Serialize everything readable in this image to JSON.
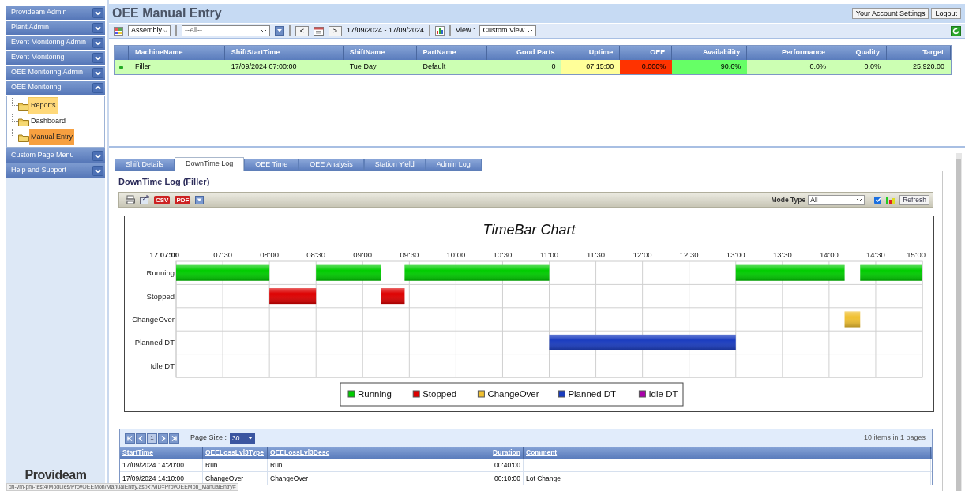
{
  "sidebar": {
    "menus": [
      {
        "label": "Provideam Admin",
        "expanded": false
      },
      {
        "label": "Plant Admin",
        "expanded": false
      },
      {
        "label": "Event Monitoring Admin",
        "expanded": false
      },
      {
        "label": "Event Monitoring",
        "expanded": false
      },
      {
        "label": "OEE Monitoring Admin",
        "expanded": false
      },
      {
        "label": "OEE Monitoring",
        "expanded": true,
        "children": [
          {
            "label": "Reports",
            "selected": false,
            "hovered": true
          },
          {
            "label": "Dashboard",
            "selected": false,
            "hovered": false
          },
          {
            "label": "Manual Entry",
            "selected": true,
            "hovered": false
          }
        ]
      },
      {
        "label": "Custom Page Menu",
        "expanded": false
      },
      {
        "label": "Help and Support",
        "expanded": false
      }
    ],
    "logo": "Provideam"
  },
  "header": {
    "title": "OEE Manual Entry",
    "buttons": [
      "Your Account Settings",
      "Logout"
    ]
  },
  "toolbar": {
    "area_select": "Assembly",
    "filter_select": "--All--",
    "prev": "<",
    "next": ">",
    "date_range": "17/09/2024 - 17/09/2024",
    "view_label": "View :",
    "view_select": "Custom View"
  },
  "machines": {
    "columns": [
      "MachineName",
      "ShiftStartTime",
      "ShiftName",
      "PartName",
      "Good Parts",
      "Uptime",
      "OEE",
      "Availability",
      "Performance",
      "Quality",
      "Target"
    ],
    "rows": [
      {
        "cells": [
          {
            "text": "Filler",
            "color": "#ccffb3"
          },
          {
            "text": "17/09/2024 07:00:00",
            "color": "#ccffb3"
          },
          {
            "text": "Tue Day",
            "color": "#ccffb3"
          },
          {
            "text": "Default",
            "color": "#ccffb3"
          },
          {
            "text": "0",
            "color": "#ccffb3"
          },
          {
            "text": "07:15:00",
            "color": "#ffff99"
          },
          {
            "text": "0.000%",
            "color": "#ff3300"
          },
          {
            "text": "90.6%",
            "color": "#66ff66"
          },
          {
            "text": "0.0%",
            "color": "#ccffb3"
          },
          {
            "text": "0.0%",
            "color": "#ccffb3"
          },
          {
            "text": "25,920.00",
            "color": "#ccffb3"
          }
        ]
      }
    ]
  },
  "tabs": [
    {
      "label": "Shift Details",
      "selected": false
    },
    {
      "label": "DownTime Log",
      "selected": true
    },
    {
      "label": "OEE Time",
      "selected": false
    },
    {
      "label": "OEE Analysis",
      "selected": false
    },
    {
      "label": "Station Yield",
      "selected": false
    },
    {
      "label": "Admin Log",
      "selected": false
    }
  ],
  "downtime": {
    "title": "DownTime Log (Filler)",
    "export_badges": [
      "CSV",
      "PDF"
    ],
    "mode_label": "Mode Type",
    "mode_value": "All",
    "show_chart": true,
    "refresh": "Refresh",
    "timebar": {
      "title": "TimeBar Chart",
      "time_labels": [
        "17 07:00",
        "07:30",
        "08:00",
        "08:30",
        "09:00",
        "09:30",
        "10:00",
        "10:30",
        "11:00",
        "11:30",
        "12:00",
        "12:30",
        "13:00",
        "13:30",
        "14:00",
        "14:30",
        "15:00"
      ],
      "lanes": [
        {
          "kind": "running",
          "label": "Running"
        },
        {
          "kind": "stopped",
          "label": "Stopped"
        },
        {
          "kind": "changeover",
          "label": "ChangeOver"
        },
        {
          "kind": "planned",
          "label": "Planned DT"
        },
        {
          "kind": "idle",
          "label": "Idle DT"
        }
      ],
      "segments": [
        {
          "kind": "running"
        },
        {
          "kind": "stopped"
        },
        {
          "kind": "running"
        },
        {
          "kind": "stopped"
        },
        {
          "kind": "running"
        },
        {
          "kind": "planned"
        },
        {
          "kind": "running"
        },
        {
          "kind": "changeover"
        },
        {
          "kind": "running"
        }
      ],
      "legend": [
        {
          "kind": "running",
          "label": "Running",
          "color": "#00cc00"
        },
        {
          "kind": "stopped",
          "label": "Stopped",
          "color": "#dd0000"
        },
        {
          "kind": "changeover",
          "label": "ChangeOver",
          "color": "#f0c030"
        },
        {
          "kind": "planned",
          "label": "Planned DT",
          "color": "#1a3cbf"
        },
        {
          "kind": "idle",
          "label": "Idle DT",
          "color": "#aa00aa"
        }
      ]
    },
    "pager": {
      "pages": [
        {
          "label": "1",
          "selected": true
        }
      ],
      "page_size_label": "Page Size :",
      "page_size": "30",
      "summary": "10 items in 1 pages"
    },
    "columns": [
      "StartTime",
      "OEELossLvl3Type",
      "OEELossLvl3Desc",
      "Duration",
      "Comment"
    ],
    "rows": [
      [
        "17/09/2024 14:20:00",
        "Run",
        "Run",
        "00:40:00",
        ""
      ],
      [
        "17/09/2024 14:10:00",
        "ChangeOver",
        "ChangeOver",
        "00:10:00",
        "Lot Change"
      ]
    ]
  },
  "status_url": "dtl-vm-pm-test4/Modules/ProvOEEMon/ManualEntry.aspx?vID=ProvOEEMon_ManualEntry#"
}
